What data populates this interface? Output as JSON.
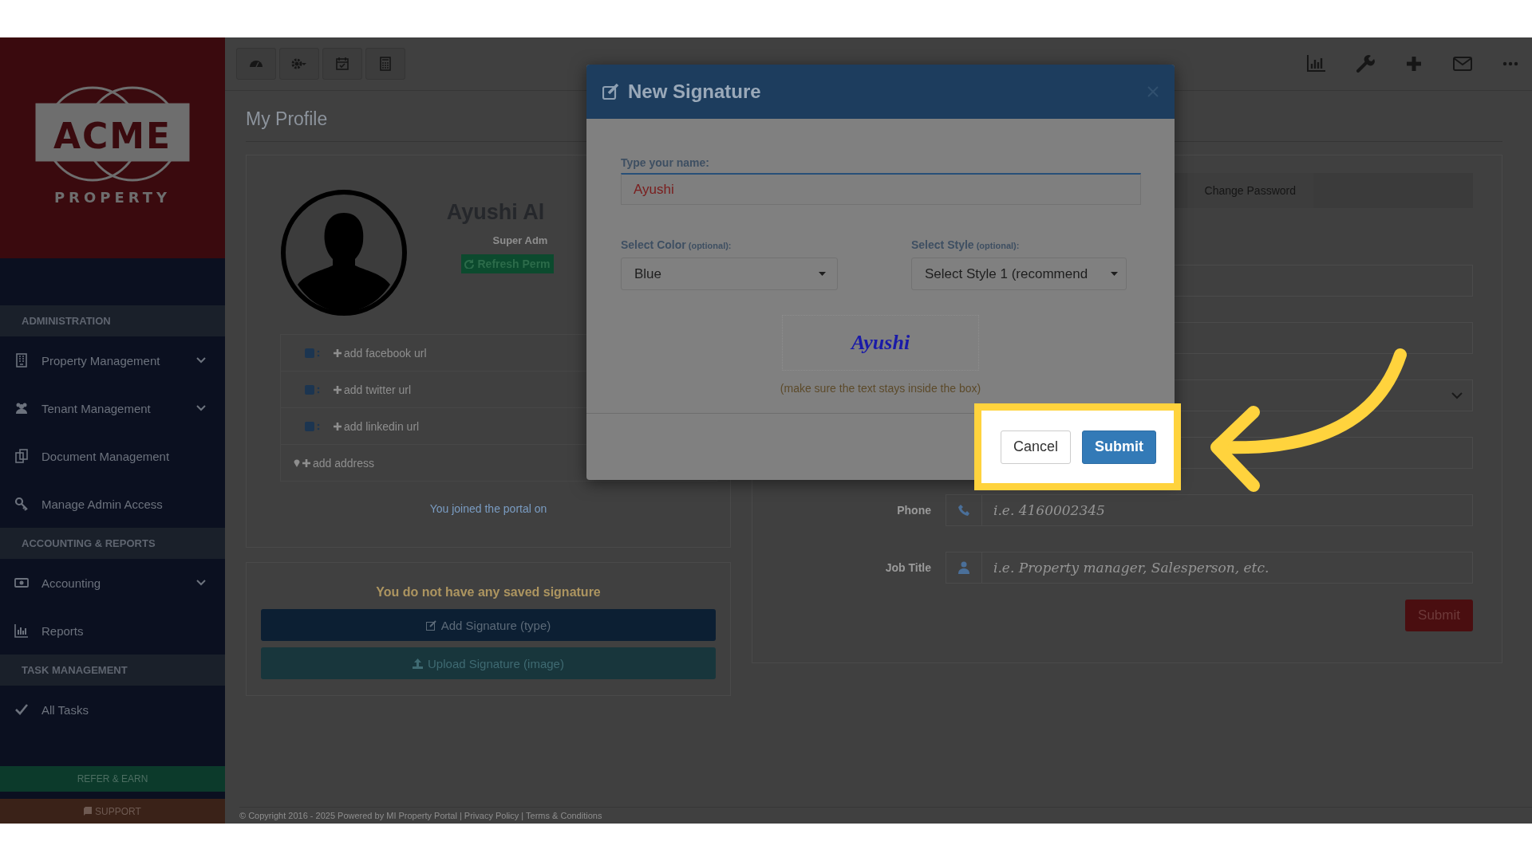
{
  "sidebar": {
    "logo": {
      "name": "ACME",
      "tagline": "PROPERTY"
    },
    "sections": [
      {
        "title": "ADMINISTRATION",
        "items": [
          {
            "label": "Property Management",
            "expandable": true
          },
          {
            "label": "Tenant Management",
            "expandable": true
          },
          {
            "label": "Document Management",
            "expandable": false
          },
          {
            "label": "Manage Admin Access",
            "expandable": false
          }
        ]
      },
      {
        "title": "ACCOUNTING & REPORTS",
        "items": [
          {
            "label": "Accounting",
            "expandable": true
          },
          {
            "label": "Reports",
            "expandable": false
          }
        ]
      },
      {
        "title": "TASK MANAGEMENT",
        "items": [
          {
            "label": "All Tasks",
            "expandable": false
          }
        ]
      }
    ],
    "refer_button": "REFER & EARN",
    "support_button": "SUPPORT"
  },
  "page": {
    "title": "My Profile",
    "profile": {
      "name": "Ayushi Al",
      "role": "Super Adm",
      "refresh_button": "Refresh Perm",
      "social_links": [
        {
          "label": "add facebook url"
        },
        {
          "label": "add twitter url"
        },
        {
          "label": "add linkedin url"
        }
      ],
      "address": "add address",
      "joined": "You joined the portal on"
    },
    "signature_card": {
      "message": "You do not have any saved signature",
      "add_button": "Add Signature (type)",
      "upload_button": "Upload Signature (image)"
    },
    "settings_card": {
      "tabs": [
        {
          "label": "Change Password",
          "selected": false
        }
      ],
      "fields": [
        {
          "kind": "text"
        },
        {
          "kind": "text"
        },
        {
          "kind": "select"
        },
        {
          "kind": "text"
        },
        {
          "kind": "phone",
          "label": "Phone",
          "placeholder": "i.e. 4160002345"
        },
        {
          "kind": "job",
          "label": "Job Title",
          "placeholder": "i.e. Property manager, Salesperson, etc."
        }
      ],
      "submit_button": "Submit"
    }
  },
  "footer": "© Copyright 2016 - 2025 Powered by MI Property Portal | Privacy Policy | Terms & Conditions",
  "modal": {
    "title": "New Signature",
    "name_label": "Type your name:",
    "name_value": "Ayushi",
    "color_label": "Select Color",
    "color_note": "(optional):",
    "color_value": "Blue",
    "style_label": "Select Style",
    "style_note": "(optional):",
    "style_value": "Select Style 1 (recommend",
    "preview": "Ayushi",
    "hint": "(make sure the text stays inside the box)",
    "buttons": [
      {
        "label": "Cancel",
        "kind": "default"
      },
      {
        "label": "Submit",
        "kind": "primary"
      }
    ]
  }
}
